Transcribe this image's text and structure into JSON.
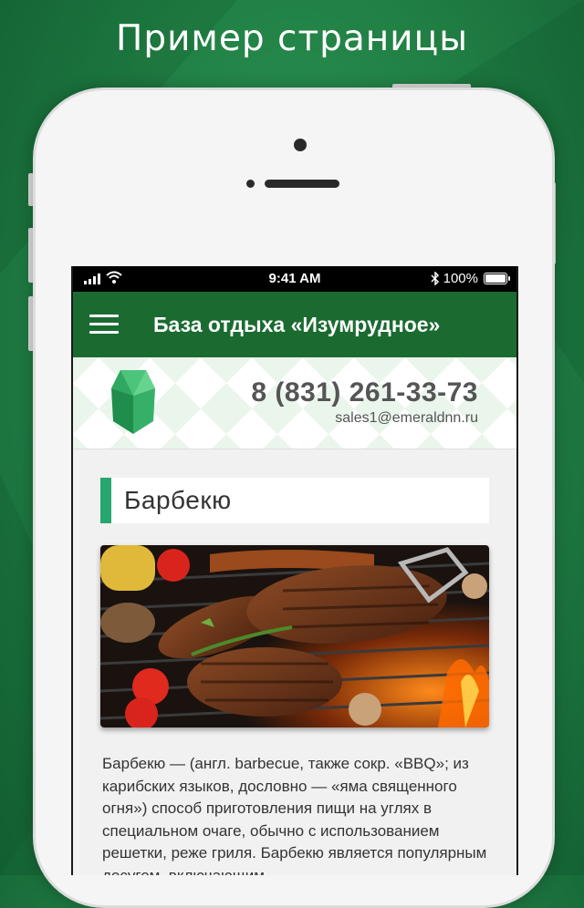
{
  "promo": {
    "title": "Пример страницы"
  },
  "status_bar": {
    "time": "9:41 AM",
    "battery": "100%"
  },
  "app_bar": {
    "title": "База отдыха «Изумрудное»",
    "menu_icon": "hamburger-menu-icon"
  },
  "header": {
    "logo_icon": "emerald-gem-icon",
    "phone": "8 (831) 261-33-73",
    "email": "sales1@emeraldnn.ru"
  },
  "page": {
    "heading": "Барбекю",
    "image_alt": "barbecue-grill-photo",
    "body": "Барбекю — (англ. barbecue, также сокр. «BBQ»; из карибских языков, дословно — «яма священного огня») способ приготовления пищи на углях в специальном очаге, обычно с использованием решетки, реже гриля. Барбекю является популярным досугом, включающим"
  },
  "colors": {
    "brand_green": "#1b6b31",
    "accent": "#27a66f",
    "background": "#207e43"
  }
}
